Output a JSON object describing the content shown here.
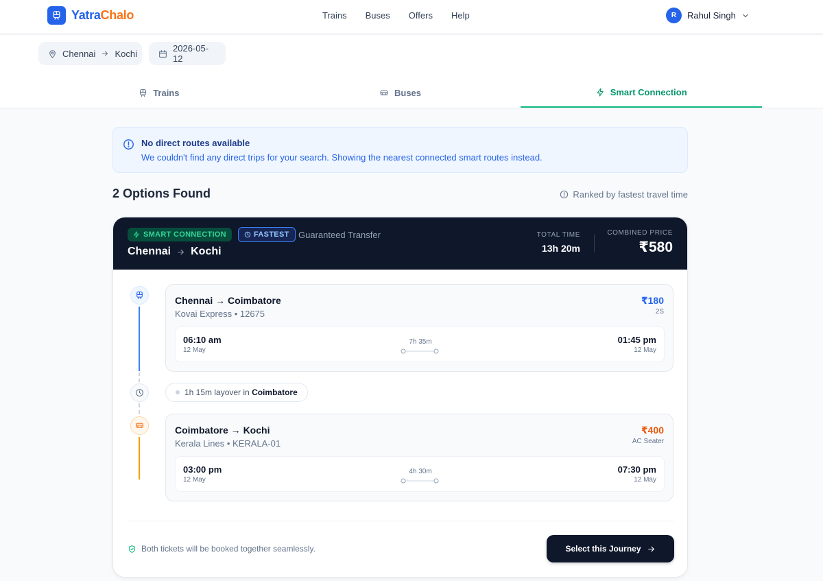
{
  "app": {
    "logo_part1": "Yatra",
    "logo_part2": "Chalo"
  },
  "nav": {
    "items": [
      "Trains",
      "Buses",
      "Offers",
      "Help"
    ]
  },
  "user": {
    "initial": "R",
    "name": "Rahul Singh"
  },
  "search": {
    "from": "Chennai",
    "to": "Kochi",
    "date": "2026-05-12"
  },
  "tabs": [
    {
      "label": "Trains",
      "icon": "train-icon",
      "active": false
    },
    {
      "label": "Buses",
      "icon": "bus-icon",
      "active": false
    },
    {
      "label": "Smart Connection",
      "icon": "lightning-icon",
      "active": true
    }
  ],
  "alert": {
    "title": "No direct routes available",
    "message": "We couldn't find any direct trips for your search. Showing the nearest connected smart routes instead."
  },
  "results": {
    "title": "2 Options Found",
    "ranking": "Ranked by fastest travel time"
  },
  "journey": {
    "badge_smart": "SMART CONNECTION",
    "badge_fastest": "FASTEST",
    "guaranteed": "Guaranteed Transfer",
    "from": "Chennai",
    "to": "Kochi",
    "total_time_label": "TOTAL TIME",
    "total_time": "13h 20m",
    "price_label": "COMBINED PRICE",
    "price": "₹580",
    "legs": [
      {
        "route": "Chennai → Coimbatore",
        "operator": "Kovai Express • 12675",
        "price": "₹180",
        "class": "2S",
        "depart_time": "06:10 am",
        "depart_date": "12 May",
        "duration": "7h 35m",
        "arrive_time": "01:45 pm",
        "arrive_date": "12 May"
      },
      {
        "route": "Coimbatore → Kochi",
        "operator": "Kerala Lines • KERALA-01",
        "price": "₹400",
        "class": "AC Seater",
        "depart_time": "03:00 pm",
        "depart_date": "12 May",
        "duration": "4h 30m",
        "arrive_time": "07:30 pm",
        "arrive_date": "12 May"
      }
    ],
    "layover_duration": "1h 15m layover in",
    "layover_city": "Coimbatore",
    "footer_note": "Both tickets will be booked together seamlessly.",
    "select_label": "Select this Journey"
  },
  "colors": {
    "primary": "#2563eb",
    "accent": "#f97316",
    "success": "#10b981",
    "dark": "#0f172a"
  }
}
